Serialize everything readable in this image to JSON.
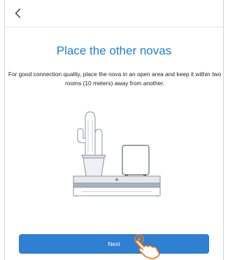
{
  "header": {
    "back_icon": "chevron-left-icon"
  },
  "main": {
    "title": "Place the other novas",
    "description": "For good connection quality, place the nova in an open area and keep it within two rooms (10 meters) away from another.",
    "illustration": "cactus-and-nova-on-cabinet"
  },
  "footer": {
    "next_label": "Next",
    "pointer_icon": "tap-hand-icon"
  },
  "colors": {
    "accent": "#1d7ed8",
    "button": "#2f7fd2",
    "hand": "#f07a1a"
  }
}
